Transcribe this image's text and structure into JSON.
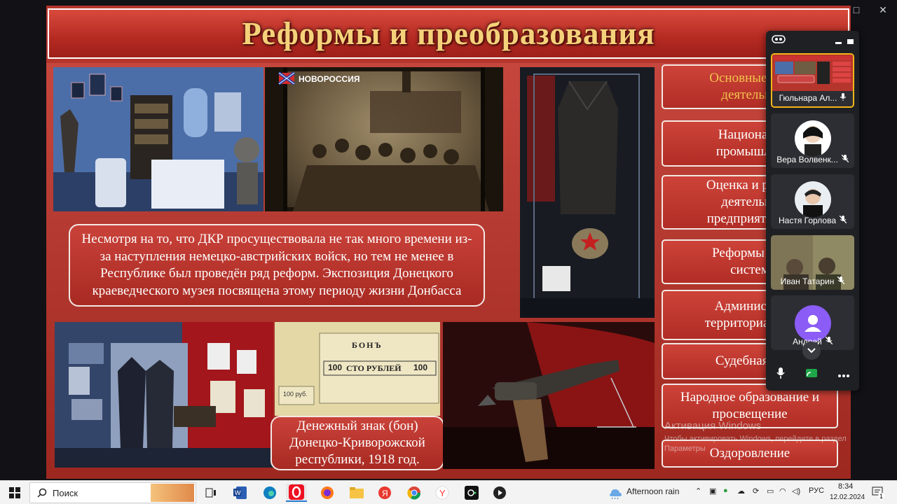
{
  "window": {
    "controls": [
      "□",
      "✕"
    ]
  },
  "slide": {
    "title": "Реформы и преобразования",
    "crowd_photo_logo": "НОВОРОССИЯ",
    "main_text": "Несмотря на то, что ДКР просуществовала не так много времени из-за наступления немецко-австрийских войск, но тем не менее в Республике был проведён ряд реформ. Экспозиция Донецкого краеведческого музея посвящена этому периоду жизни Донбасса",
    "bon_caption": "Денежный знак (бон) Донецко-Криворожской республики, 1918 год.",
    "bon_note": {
      "header": "БОНЪ",
      "denomination": "СТО РУБЛЕЙ",
      "number": "100",
      "small": "100 руб."
    },
    "buttons": [
      {
        "label": "Основные нап\nдеятельно",
        "gold": true
      },
      {
        "label": "Национали\nпромышлен"
      },
      {
        "label": "Оценка и реорг\nдеятельно\nпредприятий Д"
      },
      {
        "label": "Реформы нал\nсистем"
      },
      {
        "label": "Администра\nтерриториальна"
      },
      {
        "label": "Судебная ре"
      },
      {
        "label": "Народное образование и\nпросвещение"
      },
      {
        "label": "Оздоровление"
      }
    ]
  },
  "watermark": {
    "title": "Активация Windows",
    "subtitle": "Чтобы активировать Windows, перейдите в раздел",
    "subtitle2": "Параметры"
  },
  "meeting": {
    "participants": [
      {
        "name": "Гюльнара Ал...",
        "mic": "on",
        "kind": "screen"
      },
      {
        "name": "Вера Волвенк...",
        "mic": "muted",
        "kind": "avatar"
      },
      {
        "name": "Настя Горлова",
        "mic": "muted",
        "kind": "avatar"
      },
      {
        "name": "Иван Татарин",
        "mic": "muted",
        "kind": "video"
      },
      {
        "name": "Андрей",
        "mic": "muted",
        "kind": "placeholder"
      }
    ],
    "accent": "#8b5cf6"
  },
  "taskbar": {
    "search_label": "Поиск",
    "weather": "Afternoon rain",
    "lang": "РУС",
    "time": "8:34",
    "date": "12.02.2024",
    "notifications": "1"
  }
}
